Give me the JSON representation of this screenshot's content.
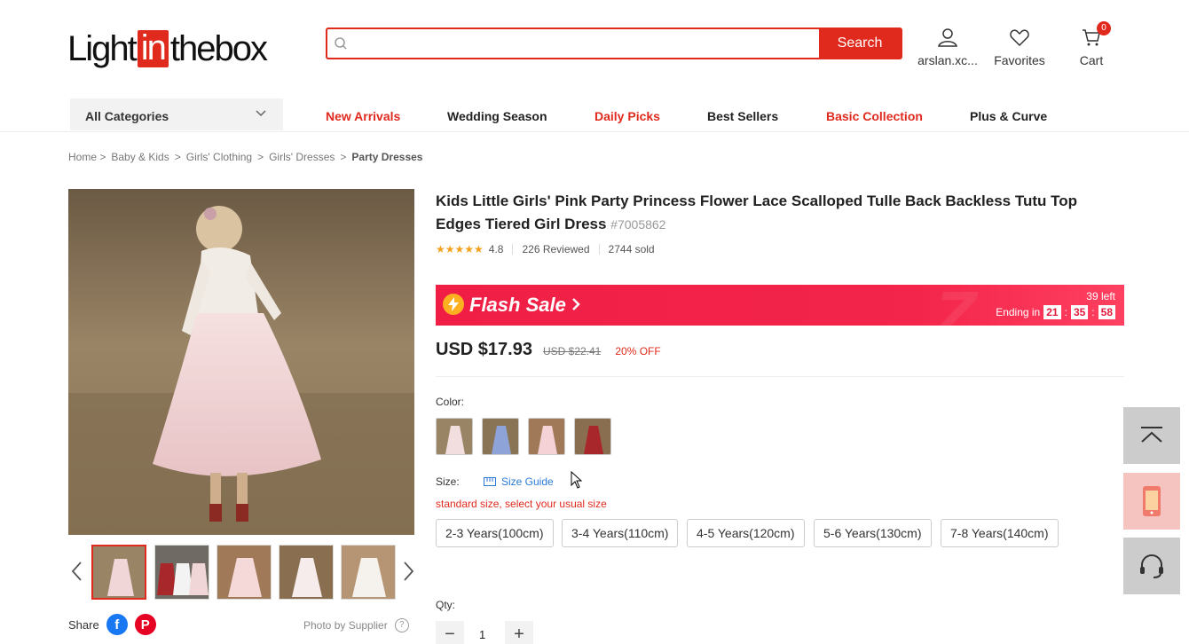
{
  "header": {
    "logo": {
      "part1": "Light",
      "part2": "in",
      "part3": "thebox"
    },
    "search": {
      "placeholder": "",
      "button_label": "Search"
    },
    "account_label": "arslan.xc...",
    "favorites_label": "Favorites",
    "cart_label": "Cart",
    "cart_count": "0"
  },
  "nav": {
    "category_select": "All Categories",
    "links": [
      "New Arrivals",
      "Wedding Season",
      "Daily Picks",
      "Best Sellers",
      "Basic Collection",
      "Plus & Curve"
    ]
  },
  "breadcrumb": [
    "Home >",
    "Baby & Kids",
    ">",
    "Girls' Clothing",
    ">",
    "Girls' Dresses",
    ">",
    "Party Dresses"
  ],
  "product": {
    "title": "Kids Little Girls' Pink Party Princess Flower Lace Scalloped Tulle Back Backless Tutu Top Edges Tiered Girl Dress",
    "sku": "#7005862",
    "stars": "★★★★★",
    "rating": "4.8",
    "reviews": "226 Reviewed",
    "sold": "2744 sold",
    "flash": {
      "title": "Flash Sale",
      "left": "39 left",
      "ending_label": "Ending in",
      "h": "21",
      "m": "35",
      "s": "58",
      "colon": ":"
    },
    "price": "USD $17.93",
    "old_price": "USD $22.41",
    "discount": "20% OFF",
    "color_label": "Color:",
    "size_label": "Size:",
    "size_guide": "Size Guide",
    "size_note": "standard size, select your usual size",
    "sizes": [
      "2-3 Years(100cm)",
      "3-4 Years(110cm)",
      "4-5 Years(120cm)",
      "5-6 Years(130cm)",
      "7-8 Years(140cm)"
    ],
    "qty_label": "Qty:",
    "qty_value": "1",
    "qty_minus": "−",
    "qty_plus": "+"
  },
  "gallery": {
    "share_label": "Share",
    "photo_by": "Photo by Supplier",
    "help": "?"
  },
  "colors": {
    "accent": "#e02a1e",
    "flash": "#f01e45",
    "link": "#2a7ad6"
  }
}
